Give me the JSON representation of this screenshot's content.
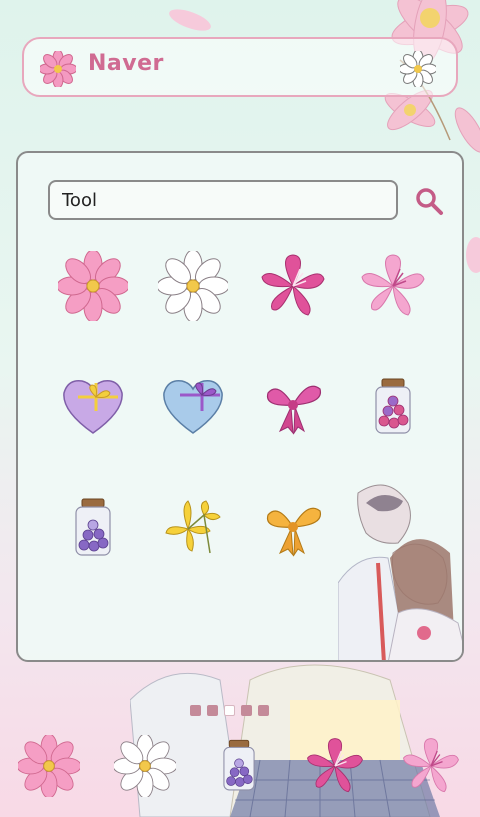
{
  "widget": {
    "title": "Naver"
  },
  "search": {
    "value": "Tool"
  },
  "apps": [
    {
      "icon": "pink-cosmos-icon"
    },
    {
      "icon": "white-cosmos-icon"
    },
    {
      "icon": "magenta-lily-icon"
    },
    {
      "icon": "light-pink-lily-icon"
    },
    {
      "icon": "purple-heart-box-icon"
    },
    {
      "icon": "blue-heart-box-icon"
    },
    {
      "icon": "pink-bow-icon"
    },
    {
      "icon": "candy-jar-icon"
    },
    {
      "icon": "berry-jar-icon"
    },
    {
      "icon": "yellow-flower-icon"
    },
    {
      "icon": "orange-bow-icon"
    }
  ],
  "pager": {
    "count": 5,
    "active": 2
  },
  "dock": [
    {
      "icon": "pink-cosmos-icon"
    },
    {
      "icon": "white-cosmos-icon"
    },
    {
      "icon": "berry-jar-icon"
    },
    {
      "icon": "magenta-lily-icon"
    },
    {
      "icon": "light-pink-lily-icon"
    }
  ],
  "colors": {
    "accent": "#d06b92",
    "border": "#8a8a8a"
  }
}
